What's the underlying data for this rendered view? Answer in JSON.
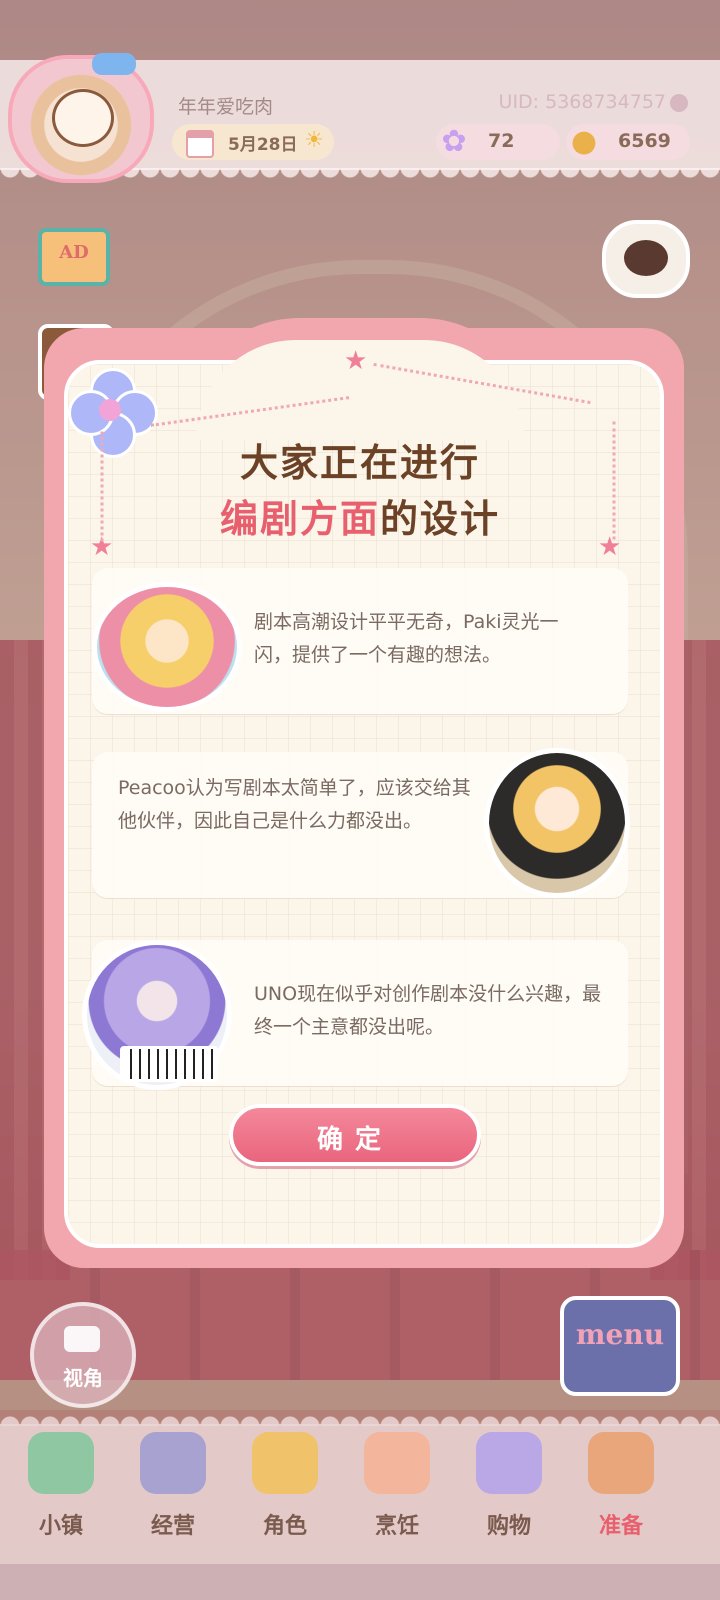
{
  "header": {
    "username": "年年爱吃肉",
    "uid": "UID: 5368734757",
    "date": "5月28日",
    "gems": "72",
    "coins": "6569"
  },
  "side": {
    "ad_label": "AD"
  },
  "dialog": {
    "title_line1": "大家正在进行",
    "title_highlight": "编剧方面",
    "title_rest": "的设计",
    "cards": [
      {
        "text": "剧本高潮设计平平无奇，Paki灵光一闪，提供了一个有趣的想法。"
      },
      {
        "text": "Peacoo认为写剧本太简单了，应该交给其他伙伴，因此自己是什么力都没出。"
      },
      {
        "text": "UNO现在似乎对创作剧本没什么兴趣，最终一个主意都没出呢。"
      }
    ],
    "confirm_label": "确定"
  },
  "controls": {
    "camera_label": "视角",
    "menu_label": "menu"
  },
  "nav": {
    "items": [
      {
        "label": "小镇",
        "color": "#8fc7a3"
      },
      {
        "label": "经营",
        "color": "#a7a2cf"
      },
      {
        "label": "角色",
        "color": "#f0c36b"
      },
      {
        "label": "烹饪",
        "color": "#f3b59b"
      },
      {
        "label": "购物",
        "color": "#b9a7e6"
      },
      {
        "label": "准备",
        "color": "#e8a67a"
      }
    ],
    "active_index": 5
  }
}
